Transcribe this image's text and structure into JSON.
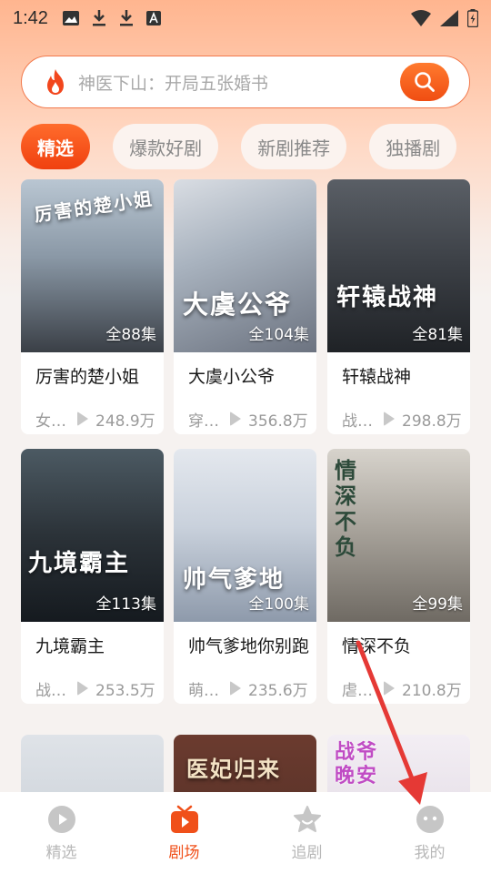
{
  "status_bar": {
    "time": "1:42"
  },
  "search": {
    "placeholder": "神医下山：开局五张婚书"
  },
  "tabs": [
    {
      "label": "精选",
      "active": true
    },
    {
      "label": "爆款好剧",
      "active": false
    },
    {
      "label": "新剧推荐",
      "active": false
    },
    {
      "label": "独播剧",
      "active": false
    }
  ],
  "dramas": [
    {
      "title": "厉害的楚小姐",
      "poster_text": "厉害的楚小姐",
      "episodes": "全88集",
      "tag": "女…",
      "views": "248.9万"
    },
    {
      "title": "大虞小公爷",
      "poster_text": "大虞公爷",
      "episodes": "全104集",
      "tag": "穿…",
      "views": "356.8万"
    },
    {
      "title": "轩辕战神",
      "poster_text": "轩辕战神",
      "episodes": "全81集",
      "tag": "战…",
      "views": "298.8万"
    },
    {
      "title": "九境霸主",
      "poster_text": "九境霸主",
      "episodes": "全113集",
      "tag": "战…",
      "views": "253.5万"
    },
    {
      "title": "帅气爹地你别跑",
      "poster_text": "帅气爹地",
      "episodes": "全100集",
      "tag": "萌…",
      "views": "235.6万"
    },
    {
      "title": "情深不负",
      "poster_text": "情深不负",
      "episodes": "全99集",
      "tag": "虐…",
      "views": "210.8万"
    },
    {
      "title": "",
      "poster_text": "",
      "episodes": "",
      "tag": "",
      "views": ""
    },
    {
      "title": "",
      "poster_text": "医妃归来",
      "episodes": "",
      "tag": "",
      "views": ""
    },
    {
      "title": "",
      "poster_text": "战爷晚安",
      "episodes": "",
      "tag": "",
      "views": ""
    }
  ],
  "bottom_nav": [
    {
      "label": "精选",
      "icon": "play-circle-icon",
      "active": false
    },
    {
      "label": "剧场",
      "icon": "tv-icon",
      "active": true
    },
    {
      "label": "追剧",
      "icon": "star-icon",
      "active": false
    },
    {
      "label": "我的",
      "icon": "profile-face-icon",
      "active": false
    }
  ],
  "colors": {
    "accent": "#f0501a",
    "search_border": "#f27a4d",
    "arrow": "#e53935"
  }
}
